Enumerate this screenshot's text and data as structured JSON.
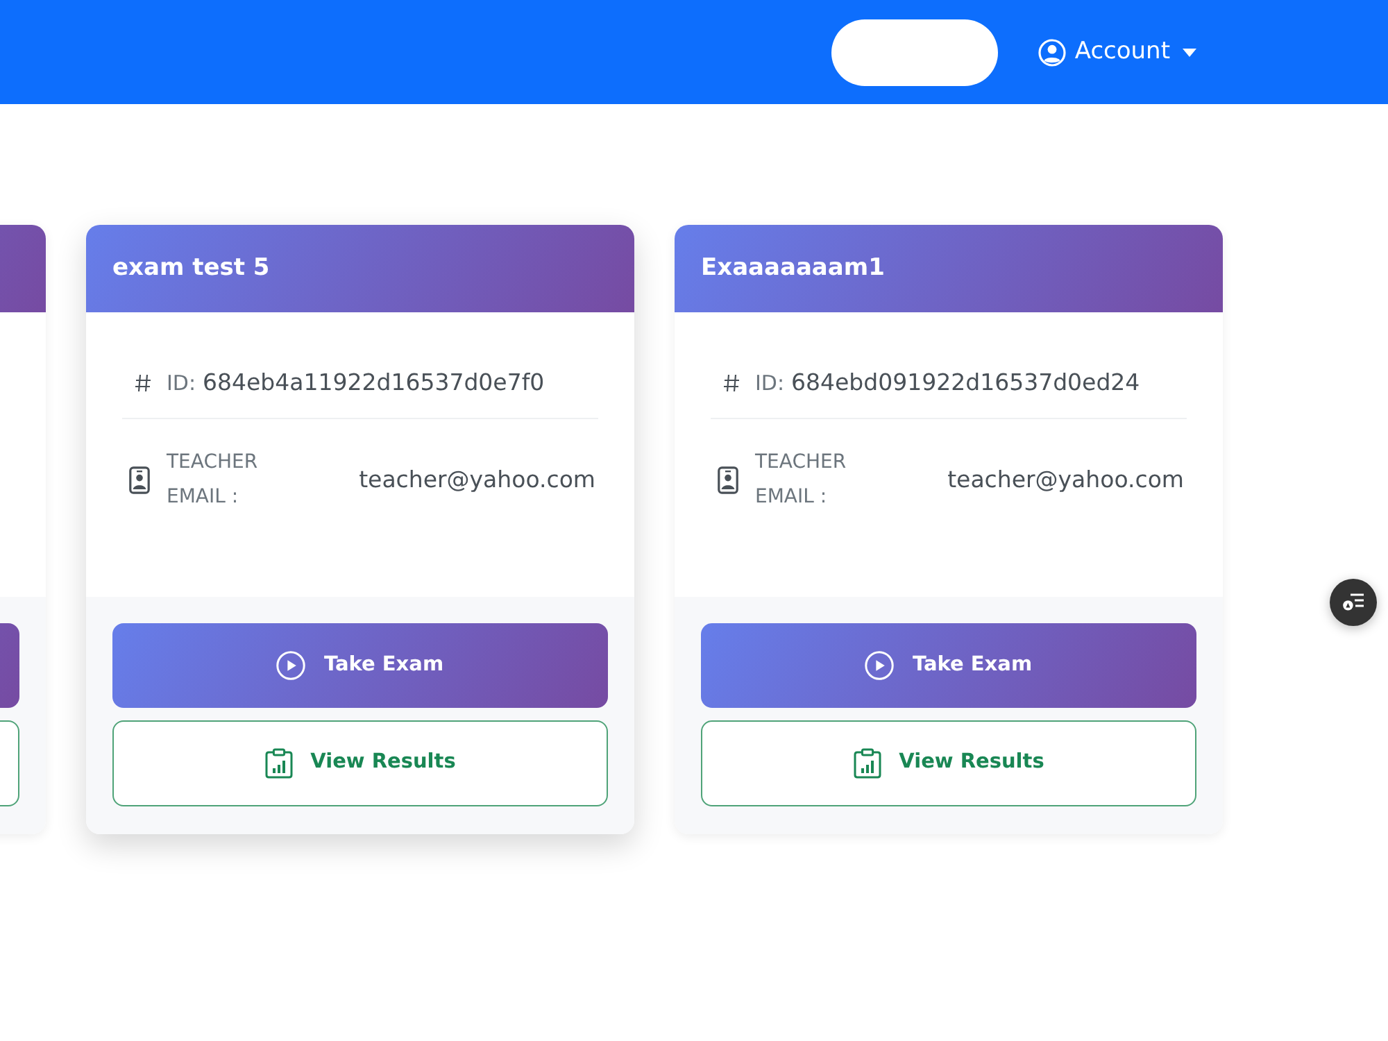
{
  "navbar": {
    "account": {
      "label": "Account"
    }
  },
  "exams": [
    {
      "title": "exam test 5",
      "hovered": true,
      "id_label": "ID:",
      "id": "684eb4a11922d16537d0e7f0",
      "email_label": "TEACHER EMAIL :",
      "email": "teacher@yahoo.com",
      "actions": [
        {
          "kind": "primary",
          "label": "Take Exam"
        },
        {
          "kind": "outline",
          "label": "View Results"
        }
      ]
    },
    {
      "title": "Exaaaaaaam1",
      "hovered": false,
      "id_label": "ID:",
      "id": "684ebd091922d16537d0ed24",
      "email_label": "TEACHER EMAIL :",
      "email": "teacher@yahoo.com",
      "actions": [
        {
          "kind": "primary",
          "label": "Take Exam"
        },
        {
          "kind": "outline",
          "label": "View Results"
        }
      ]
    }
  ]
}
